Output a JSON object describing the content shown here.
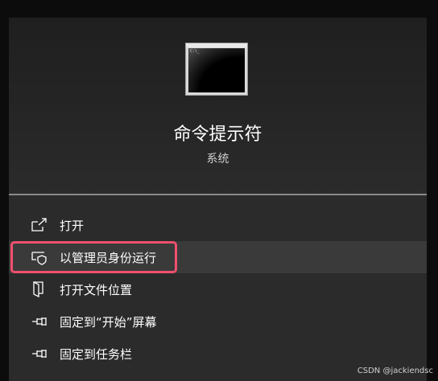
{
  "app": {
    "name": "命令提示符",
    "category": "系统",
    "icon": "command-prompt-icon",
    "icon_prompt_text": "C:\\_"
  },
  "menu": {
    "items": [
      {
        "label": "打开",
        "icon": "open-icon"
      },
      {
        "label": "以管理员身份运行",
        "icon": "shield-icon"
      },
      {
        "label": "打开文件位置",
        "icon": "file-location-icon"
      },
      {
        "label": "固定到“开始”屏幕",
        "icon": "pin-icon"
      },
      {
        "label": "固定到任务栏",
        "icon": "pin-icon"
      }
    ],
    "highlighted_index": 1
  },
  "callout_color": "#f0506e",
  "watermark": "CSDN @jackiendsc"
}
